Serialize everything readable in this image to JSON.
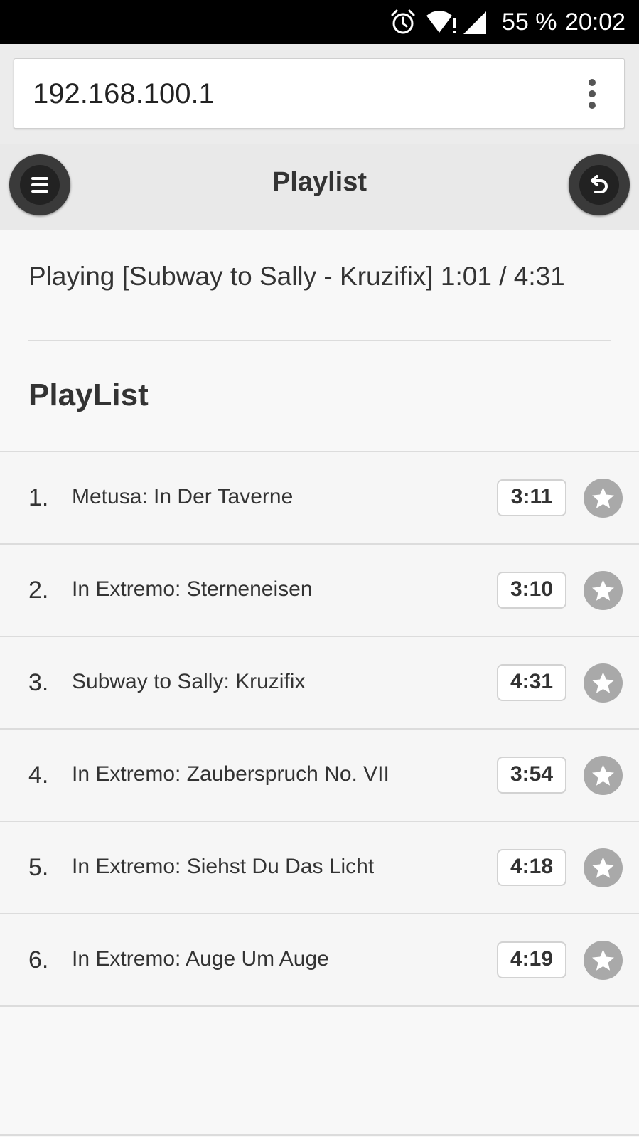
{
  "status_bar": {
    "battery": "55 %",
    "time": "20:02",
    "icons": [
      "alarm-icon",
      "wifi-warning-icon",
      "cell-signal-icon"
    ]
  },
  "browser": {
    "url": "192.168.100.1",
    "menu_icon": "more-vert-icon"
  },
  "header": {
    "title": "Playlist",
    "left_icon": "menu-icon",
    "right_icon": "undo-icon"
  },
  "now_playing": "Playing [Subway to Sally - Kruzifix] 1:01 / 4:31",
  "section_title": "PlayList",
  "playlist": [
    {
      "num": "1.",
      "title": "Metusa: In Der Taverne",
      "duration": "3:11"
    },
    {
      "num": "2.",
      "title": "In Extremo: Sterneneisen",
      "duration": "3:10"
    },
    {
      "num": "3.",
      "title": "Subway to Sally: Kruzifix",
      "duration": "4:31"
    },
    {
      "num": "4.",
      "title": "In Extremo: Zauberspruch No. VII",
      "duration": "3:54"
    },
    {
      "num": "5.",
      "title": "In Extremo: Siehst Du Das Licht",
      "duration": "4:18"
    },
    {
      "num": "6.",
      "title": "In Extremo: Auge Um Auge",
      "duration": "4:19"
    }
  ],
  "colors": {
    "status_bar": "#000000",
    "header_bg": "#e9e9e9",
    "button_dark": "#3a3a3a",
    "star_bg": "#a9a9a9"
  }
}
